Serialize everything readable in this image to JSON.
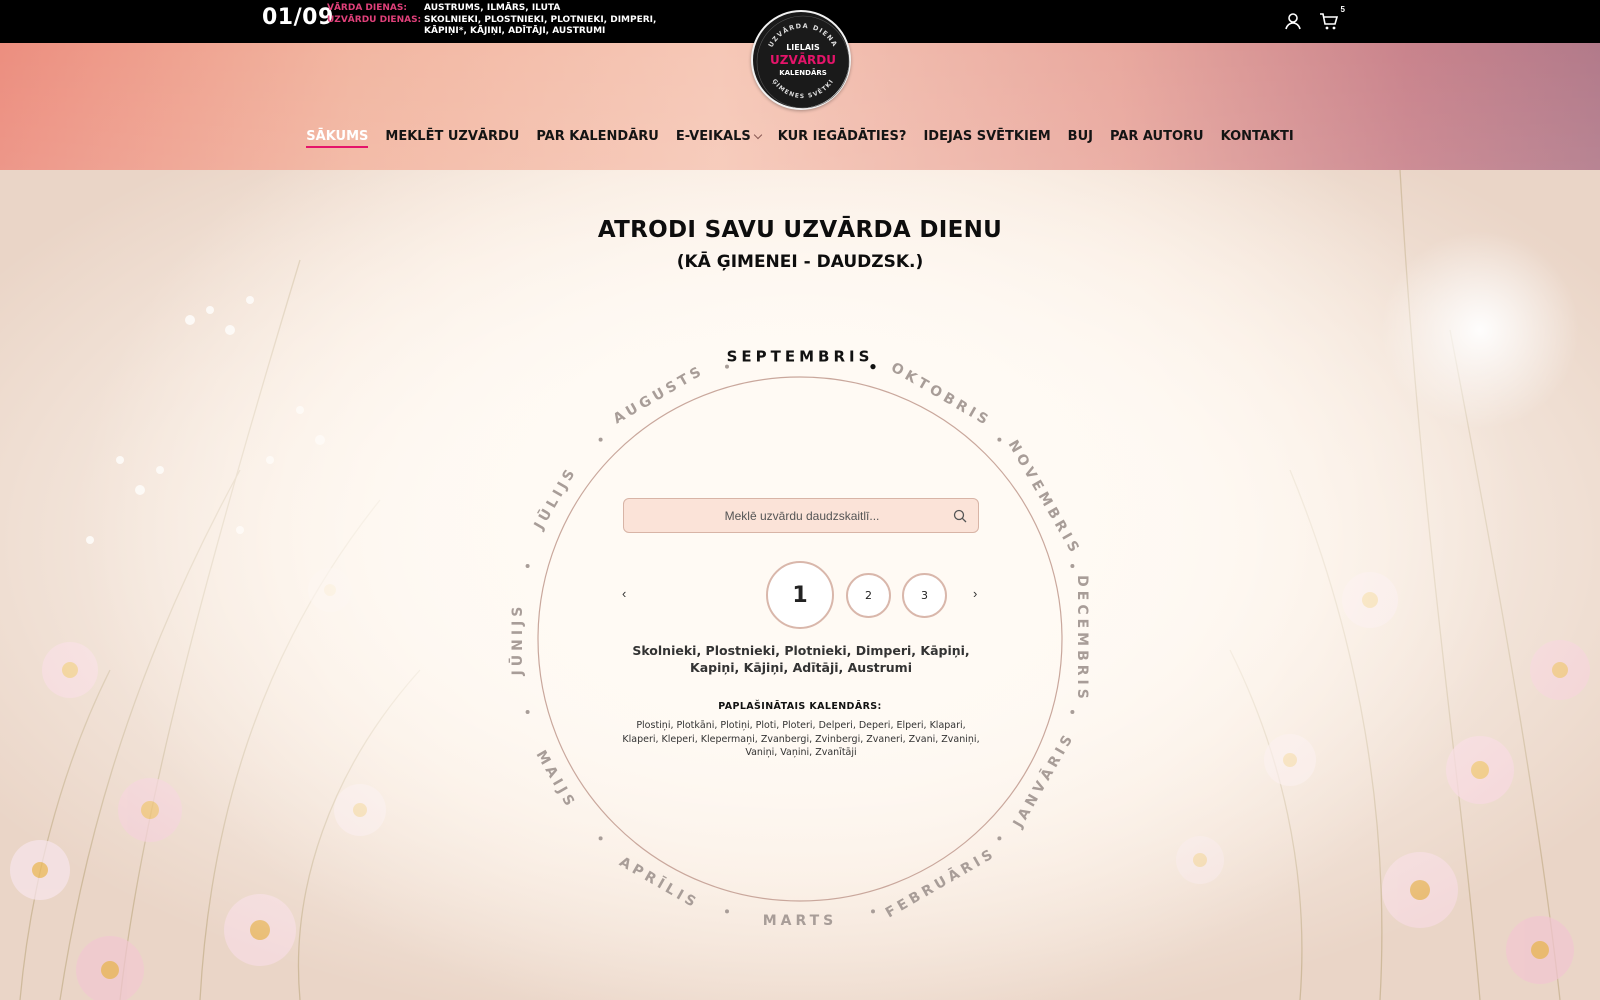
{
  "topbar": {
    "date": "01/09",
    "name_days_label": "VĀRDA DIENAS:",
    "name_days_value": "AUSTRUMS, ILMĀRS, ILUTA",
    "surname_days_label": "UZVĀRDU DIENAS:",
    "surname_days_value": "SKOLNIEKI, PLOSTNIEKI, PLOTNIEKI, DIMPERI, KĀPIŅI*, KĀJIŅI, ADĪTĀJI, AUSTRUMI",
    "cart_count": "5",
    "icons": [
      "user-icon",
      "cart-icon"
    ]
  },
  "logo": {
    "arc_top": "UZVĀRDA DIENA",
    "line1": "LIELAIS",
    "line2": "UZVĀRDU",
    "line3": "KALENDĀRS",
    "arc_bottom": "ĢIMENES SVĒTKI",
    "accent": "#e5146a"
  },
  "nav": [
    {
      "label": "SĀKUMS",
      "active": true
    },
    {
      "label": "MEKLĒT UZVĀRDU",
      "active": false
    },
    {
      "label": "PAR KALENDĀRU",
      "active": false
    },
    {
      "label": "E-VEIKALS",
      "active": false
    },
    {
      "label": "KUR IEGĀDĀTIES?",
      "active": false
    },
    {
      "label": "IDEJAS SVĒTKIEM",
      "active": false
    },
    {
      "label": "BUJ",
      "active": false
    },
    {
      "label": "PAR AUTORU",
      "active": false
    },
    {
      "label": "KONTAKTI",
      "active": false
    }
  ],
  "hero": {
    "title": "ATRODI SAVU UZVĀRDA DIENU",
    "subtitle": "(KĀ ĢIMENEI - DAUDZSK.)"
  },
  "months": {
    "current": "SEPTEMBRIS",
    "others": [
      "OKTOBRIS",
      "NOVEMBRIS",
      "DECEMBRIS",
      "JANVĀRIS",
      "FEBRUĀRIS",
      "MARTS",
      "APRĪLIS",
      "MAIJS",
      "JŪNIJS",
      "JŪLIJS",
      "AUGUSTS"
    ]
  },
  "search": {
    "placeholder": "Meklē uzvārdu daudzskaitlī..."
  },
  "pager": {
    "prev": "‹",
    "next": "›",
    "current": "1",
    "pages": [
      "2",
      "3"
    ]
  },
  "day": {
    "names": "Skolnieki, Plostnieki, Plotnieki, Dimperi, Kāpiņi, Kapiņi, Kājiņi, Adītāji, Austrumi",
    "extended_title": "PAPLAŠINĀTAIS KALENDĀRS:",
    "extended_names": "Plostiņi, Plotkāni, Plotiņi, Ploti, Ploteri, Delperi, Deperi, Elperi, Klapari, Klaperi, Kleperi, Klepermaņi, Zvanbergi, Zvinbergi, Zvaneri, Zvani, Zvaniņi, Vaniņi, Vaņini, Zvanītāji"
  },
  "colors": {
    "accent": "#e5146a",
    "ring": "#c9a79c"
  }
}
